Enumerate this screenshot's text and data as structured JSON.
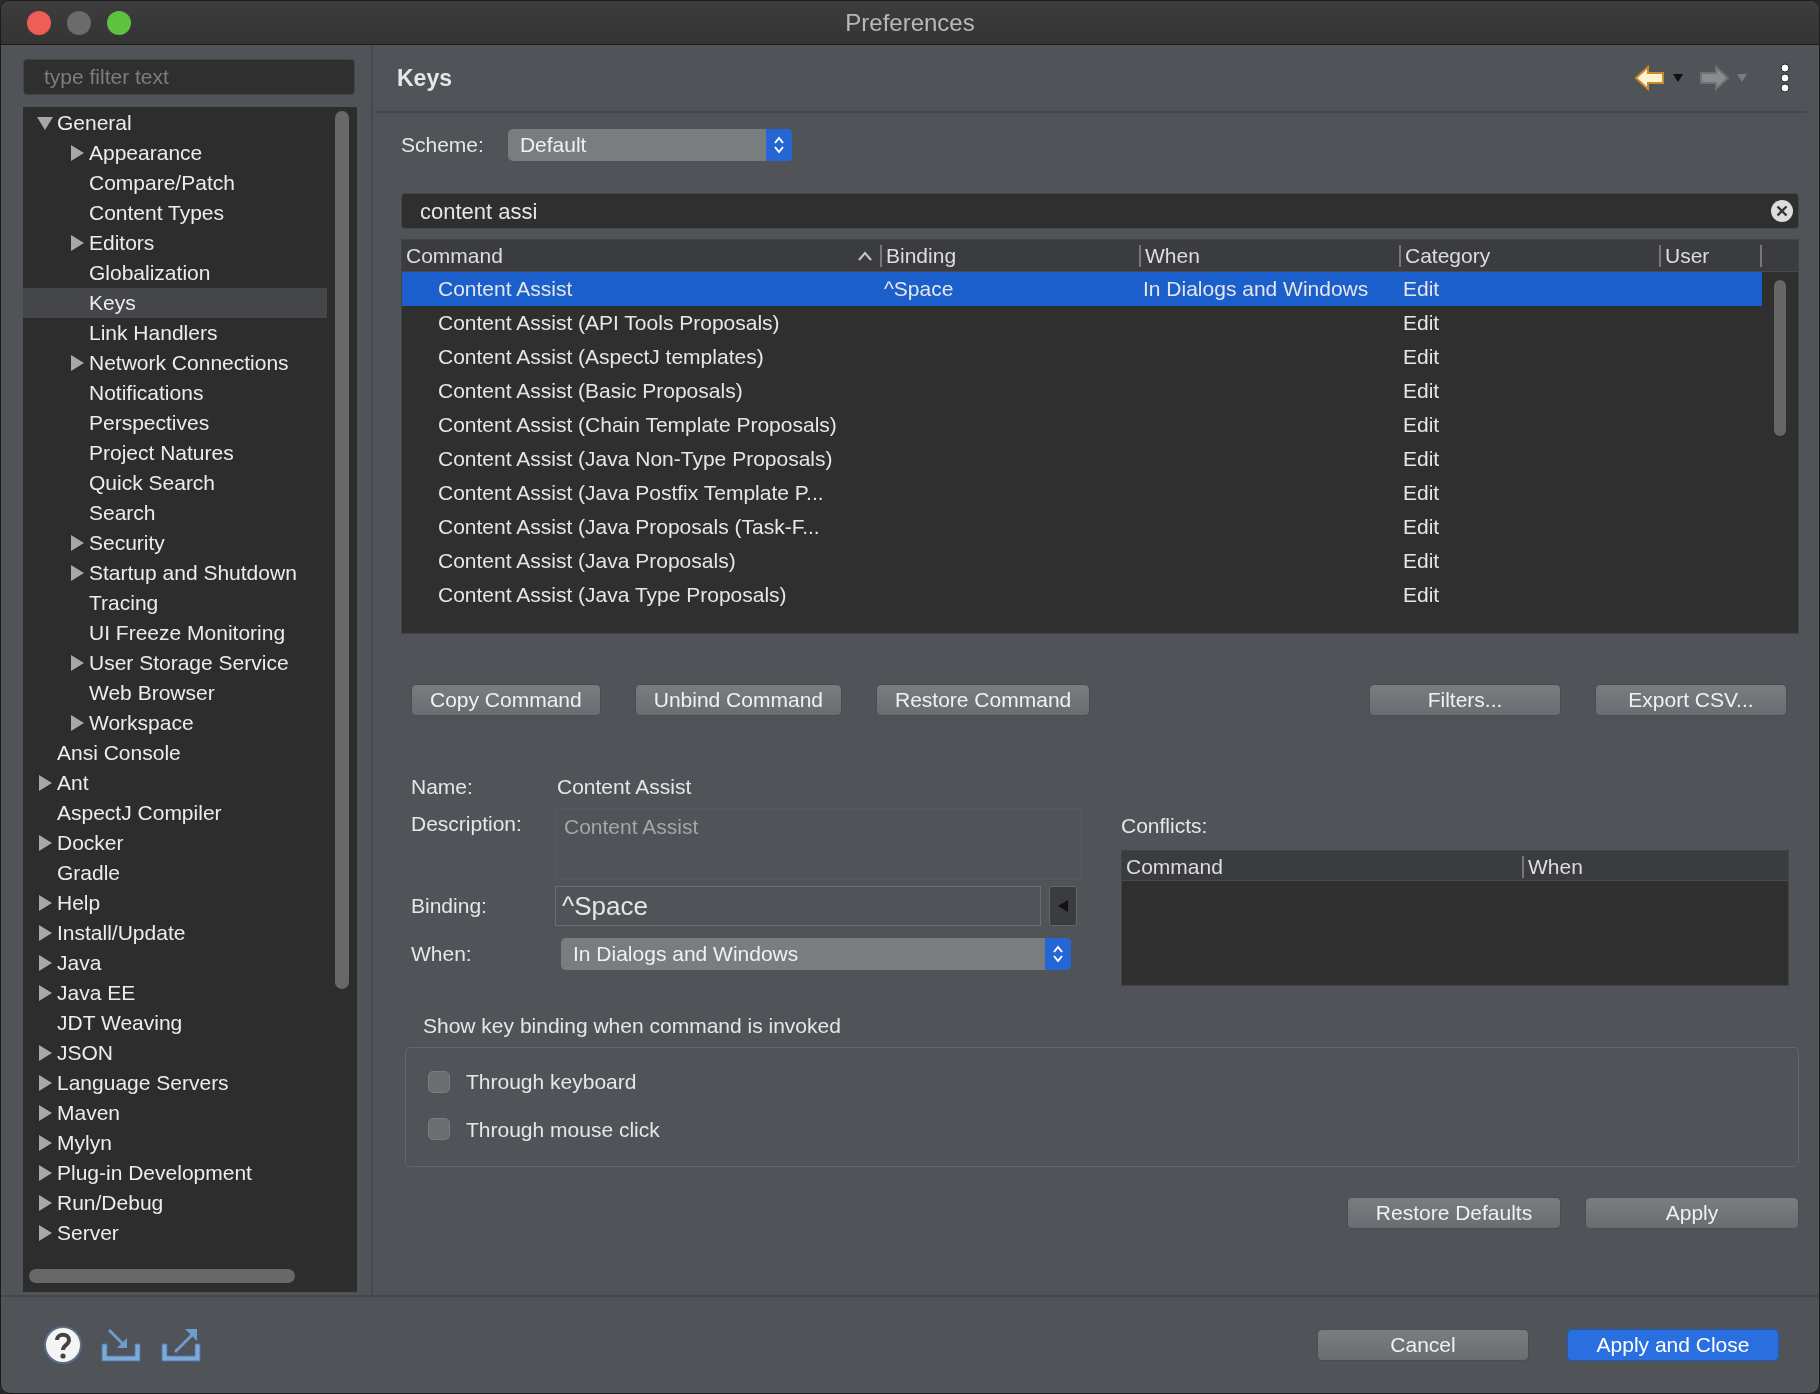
{
  "window": {
    "title": "Preferences"
  },
  "sidebar": {
    "filter": {
      "placeholder": "type filter text"
    },
    "tree": [
      {
        "label": "General",
        "kind": "branch",
        "expanded": true,
        "selected": false,
        "children": [
          {
            "label": "Appearance",
            "kind": "branch",
            "expanded": false,
            "selected": false
          },
          {
            "label": "Compare/Patch",
            "kind": "leaf",
            "selected": false
          },
          {
            "label": "Content Types",
            "kind": "leaf",
            "selected": false
          },
          {
            "label": "Editors",
            "kind": "branch",
            "expanded": false,
            "selected": false
          },
          {
            "label": "Globalization",
            "kind": "leaf",
            "selected": false
          },
          {
            "label": "Keys",
            "kind": "leaf",
            "selected": true
          },
          {
            "label": "Link Handlers",
            "kind": "leaf",
            "selected": false
          },
          {
            "label": "Network Connections",
            "kind": "branch",
            "expanded": false,
            "selected": false
          },
          {
            "label": "Notifications",
            "kind": "leaf",
            "selected": false
          },
          {
            "label": "Perspectives",
            "kind": "leaf",
            "selected": false
          },
          {
            "label": "Project Natures",
            "kind": "leaf",
            "selected": false
          },
          {
            "label": "Quick Search",
            "kind": "leaf",
            "selected": false
          },
          {
            "label": "Search",
            "kind": "leaf",
            "selected": false
          },
          {
            "label": "Security",
            "kind": "branch",
            "expanded": false,
            "selected": false
          },
          {
            "label": "Startup and Shutdown",
            "kind": "branch",
            "expanded": false,
            "selected": false
          },
          {
            "label": "Tracing",
            "kind": "leaf",
            "selected": false
          },
          {
            "label": "UI Freeze Monitoring",
            "kind": "leaf",
            "selected": false
          },
          {
            "label": "User Storage Service",
            "kind": "branch",
            "expanded": false,
            "selected": false
          },
          {
            "label": "Web Browser",
            "kind": "leaf",
            "selected": false
          },
          {
            "label": "Workspace",
            "kind": "branch",
            "expanded": false,
            "selected": false
          }
        ]
      },
      {
        "label": "Ansi Console",
        "kind": "leaf",
        "selected": false
      },
      {
        "label": "Ant",
        "kind": "branch",
        "expanded": false,
        "selected": false
      },
      {
        "label": "AspectJ Compiler",
        "kind": "leaf",
        "selected": false
      },
      {
        "label": "Docker",
        "kind": "branch",
        "expanded": false,
        "selected": false
      },
      {
        "label": "Gradle",
        "kind": "leaf",
        "selected": false
      },
      {
        "label": "Help",
        "kind": "branch",
        "expanded": false,
        "selected": false
      },
      {
        "label": "Install/Update",
        "kind": "branch",
        "expanded": false,
        "selected": false
      },
      {
        "label": "Java",
        "kind": "branch",
        "expanded": false,
        "selected": false
      },
      {
        "label": "Java EE",
        "kind": "branch",
        "expanded": false,
        "selected": false
      },
      {
        "label": "JDT Weaving",
        "kind": "leaf",
        "selected": false
      },
      {
        "label": "JSON",
        "kind": "branch",
        "expanded": false,
        "selected": false
      },
      {
        "label": "Language Servers",
        "kind": "branch",
        "expanded": false,
        "selected": false
      },
      {
        "label": "Maven",
        "kind": "branch",
        "expanded": false,
        "selected": false
      },
      {
        "label": "Mylyn",
        "kind": "branch",
        "expanded": false,
        "selected": false
      },
      {
        "label": "Plug-in Development",
        "kind": "branch",
        "expanded": false,
        "selected": false
      },
      {
        "label": "Run/Debug",
        "kind": "branch",
        "expanded": false,
        "selected": false
      },
      {
        "label": "Server",
        "kind": "branch",
        "expanded": false,
        "selected": false
      }
    ]
  },
  "page": {
    "title": "Keys"
  },
  "scheme": {
    "label": "Scheme:",
    "value": "Default"
  },
  "search": {
    "value": "content assi"
  },
  "table": {
    "columns": [
      {
        "label": "Command",
        "sorted": true
      },
      {
        "label": "Binding",
        "sorted": false
      },
      {
        "label": "When",
        "sorted": false
      },
      {
        "label": "Category",
        "sorted": false
      },
      {
        "label": "User",
        "sorted": false
      }
    ],
    "rows": [
      {
        "command": "Content Assist",
        "binding": "^Space",
        "when": "In Dialogs and Windows",
        "category": "Edit",
        "selected": true
      },
      {
        "command": "Content Assist (API Tools Proposals)",
        "category": "Edit",
        "selected": false
      },
      {
        "command": "Content Assist (AspectJ templates)",
        "category": "Edit",
        "selected": false
      },
      {
        "command": "Content Assist (Basic Proposals)",
        "category": "Edit",
        "selected": false
      },
      {
        "command": "Content Assist (Chain Template Proposals)",
        "category": "Edit",
        "selected": false
      },
      {
        "command": "Content Assist (Java Non-Type Proposals)",
        "category": "Edit",
        "selected": false
      },
      {
        "command": "Content Assist (Java Postfix Template P...",
        "category": "Edit",
        "selected": false
      },
      {
        "command": "Content Assist (Java Proposals (Task-F...",
        "category": "Edit",
        "selected": false
      },
      {
        "command": "Content Assist (Java Proposals)",
        "category": "Edit",
        "selected": false
      },
      {
        "command": "Content Assist (Java Type Proposals)",
        "category": "Edit",
        "selected": false
      }
    ]
  },
  "table_buttons": [
    "Copy Command",
    "Unbind Command",
    "Restore Command",
    "Filters...",
    "Export CSV..."
  ],
  "details": {
    "name_label": "Name:",
    "name": "Content Assist",
    "description_label": "Description:",
    "description": "Content Assist",
    "binding_label": "Binding:",
    "binding": "^Space",
    "when_label": "When:",
    "when": "In Dialogs and Windows"
  },
  "conflicts": {
    "label": "Conflicts:",
    "columns": [
      "Command",
      "When"
    ]
  },
  "show_binding": {
    "label": "Show key binding when command is invoked",
    "options": [
      {
        "label": "Through keyboard",
        "checked": false
      },
      {
        "label": "Through mouse click",
        "checked": false
      }
    ]
  },
  "page_buttons": [
    "Restore Defaults",
    "Apply"
  ],
  "dialog_buttons": [
    {
      "label": "Cancel",
      "default": false
    },
    {
      "label": "Apply and Close",
      "default": true
    }
  ]
}
